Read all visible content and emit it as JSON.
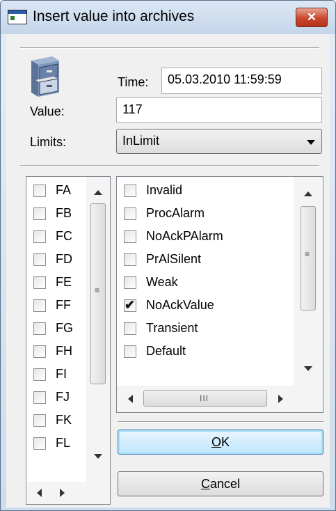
{
  "window": {
    "title": "Insert value into archives",
    "close_label": "✕"
  },
  "form": {
    "time_label": "Time:",
    "time_value": "05.03.2010  11:59:59",
    "value_label": "Value:",
    "value_value": "117",
    "limits_label": "Limits:",
    "limits_selected": "InLimit"
  },
  "left_list": {
    "items": [
      {
        "label": "FA",
        "checked": false
      },
      {
        "label": "FB",
        "checked": false
      },
      {
        "label": "FC",
        "checked": false
      },
      {
        "label": "FD",
        "checked": false
      },
      {
        "label": "FE",
        "checked": false
      },
      {
        "label": "FF",
        "checked": false
      },
      {
        "label": "FG",
        "checked": false
      },
      {
        "label": "FH",
        "checked": false
      },
      {
        "label": "FI",
        "checked": false
      },
      {
        "label": "FJ",
        "checked": false
      },
      {
        "label": "FK",
        "checked": false
      },
      {
        "label": "FL",
        "checked": false
      }
    ]
  },
  "right_list": {
    "items": [
      {
        "label": "Invalid",
        "checked": false
      },
      {
        "label": "ProcAlarm",
        "checked": false
      },
      {
        "label": "NoAckPAlarm",
        "checked": false
      },
      {
        "label": "PrAlSilent",
        "checked": false
      },
      {
        "label": "Weak",
        "checked": false
      },
      {
        "label": "NoAckValue",
        "checked": true
      },
      {
        "label": "Transient",
        "checked": false
      },
      {
        "label": "Default",
        "checked": false
      }
    ]
  },
  "buttons": {
    "ok_mnemonic": "O",
    "ok_rest": "K",
    "cancel_mnemonic": "C",
    "cancel_rest": "ancel"
  },
  "icons": {
    "archive": "file-cabinet-icon",
    "close": "close-icon",
    "dropdown": "chevron-down-icon"
  }
}
